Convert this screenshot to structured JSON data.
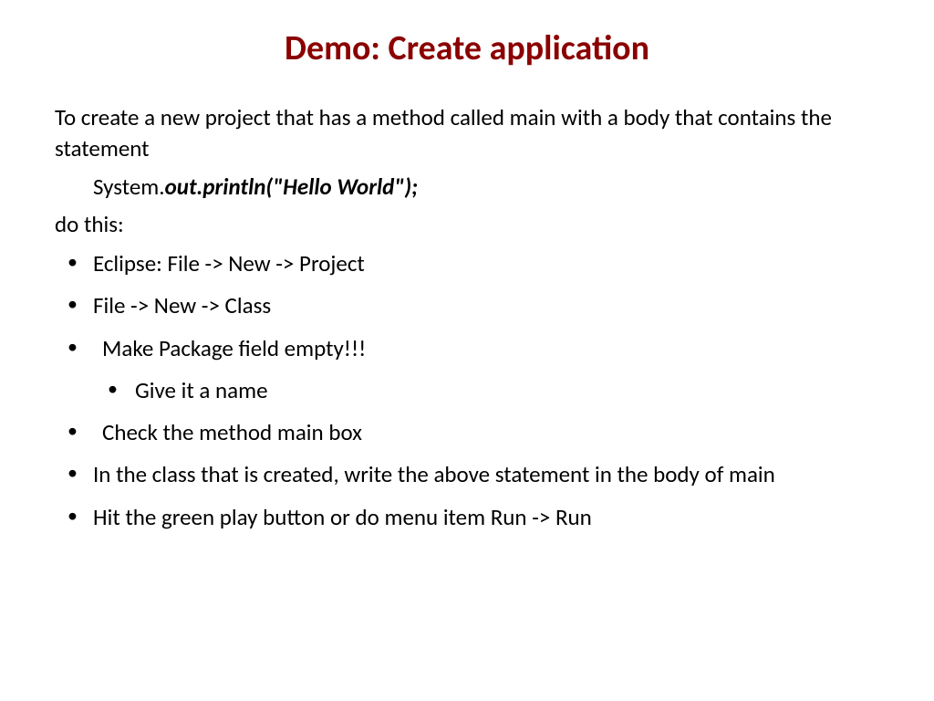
{
  "title": "Demo: Create application",
  "intro": "To create a new project that has a method called main with a body that contains the statement",
  "code": {
    "prefix": "System.",
    "bold": "out.println(\"Hello World\");"
  },
  "doThis": "do this:",
  "bullets": {
    "b1": "Eclipse: File -> New -> Project",
    "b2": "File -> New -> Class",
    "b3": "Make Package field empty!!!",
    "b4": "Give it a name",
    "b5": "Check the method main box",
    "b6": "In the class that is created, write the above statement in the body of main",
    "b7": "Hit the green play button or do menu item Run -> Run"
  }
}
